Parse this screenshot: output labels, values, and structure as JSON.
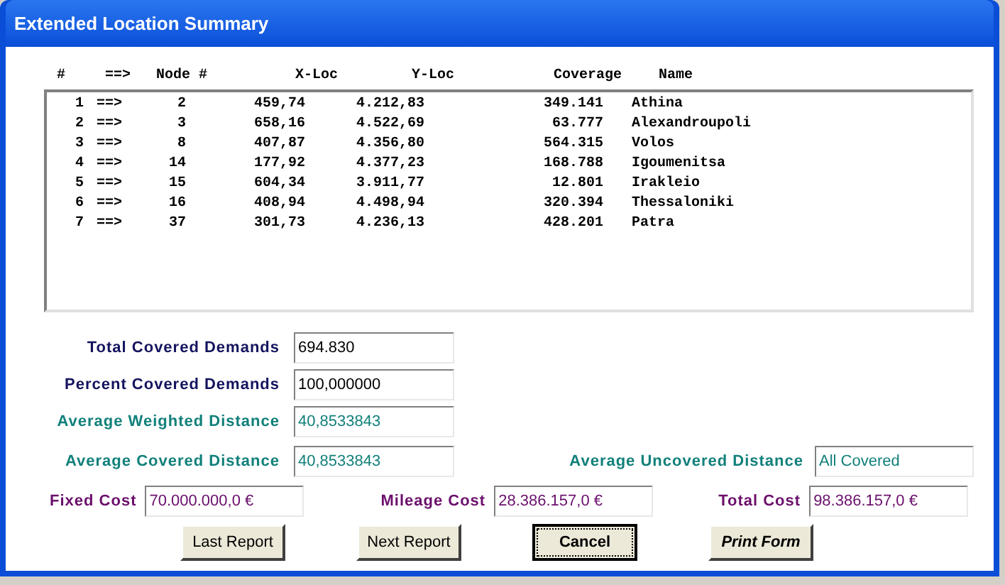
{
  "window": {
    "title": "Extended Location Summary"
  },
  "list": {
    "columns": [
      "#",
      "==>",
      "Node #",
      "X-Loc",
      "Y-Loc",
      "Coverage",
      "Name"
    ],
    "rows": [
      {
        "index": "1",
        "arrow": "==>",
        "node": "2",
        "x_loc": "459,74",
        "y_loc": "4.212,83",
        "coverage": "349.141",
        "name": "Athina"
      },
      {
        "index": "2",
        "arrow": "==>",
        "node": "3",
        "x_loc": "658,16",
        "y_loc": "4.522,69",
        "coverage": "63.777",
        "name": "Alexandroupoli"
      },
      {
        "index": "3",
        "arrow": "==>",
        "node": "8",
        "x_loc": "407,87",
        "y_loc": "4.356,80",
        "coverage": "564.315",
        "name": "Volos"
      },
      {
        "index": "4",
        "arrow": "==>",
        "node": "14",
        "x_loc": "177,92",
        "y_loc": "4.377,23",
        "coverage": "168.788",
        "name": "Igoumenitsa"
      },
      {
        "index": "5",
        "arrow": "==>",
        "node": "15",
        "x_loc": "604,34",
        "y_loc": "3.911,77",
        "coverage": "12.801",
        "name": "Irakleio"
      },
      {
        "index": "6",
        "arrow": "==>",
        "node": "16",
        "x_loc": "408,94",
        "y_loc": "4.498,94",
        "coverage": "320.394",
        "name": "Thessaloniki"
      },
      {
        "index": "7",
        "arrow": "==>",
        "node": "37",
        "x_loc": "301,73",
        "y_loc": "4.236,13",
        "coverage": "428.201",
        "name": "Patra"
      }
    ]
  },
  "left_fields": [
    {
      "label": "Total Covered Demands",
      "value": "694.830",
      "kind": "demand"
    },
    {
      "label": "Percent Covered Demands",
      "value": "100,000000",
      "kind": "demand"
    },
    {
      "label": "Average Weighted Distance",
      "value": "40,8533843",
      "kind": "distance"
    },
    {
      "label": "Average Covered Distance",
      "value": "40,8533843",
      "kind": "distance"
    }
  ],
  "uncovered_field": {
    "label": "Average Uncovered Distance",
    "value": "All Covered",
    "kind": "distance"
  },
  "cost_fields": [
    {
      "label": "Fixed Cost",
      "value": "70.000.000,0 €",
      "kind": "cost"
    },
    {
      "label": "Mileage Cost",
      "value": "28.386.157,0 €",
      "kind": "cost"
    },
    {
      "label": "Total Cost",
      "value": "98.386.157,0 €",
      "kind": "cost"
    }
  ],
  "buttons": [
    {
      "label": "Last Report",
      "kind": "plain"
    },
    {
      "label": "Next Report",
      "kind": "plain"
    },
    {
      "label": "Cancel",
      "kind": "focused"
    },
    {
      "label": "Print Form",
      "kind": "emphasized"
    }
  ]
}
